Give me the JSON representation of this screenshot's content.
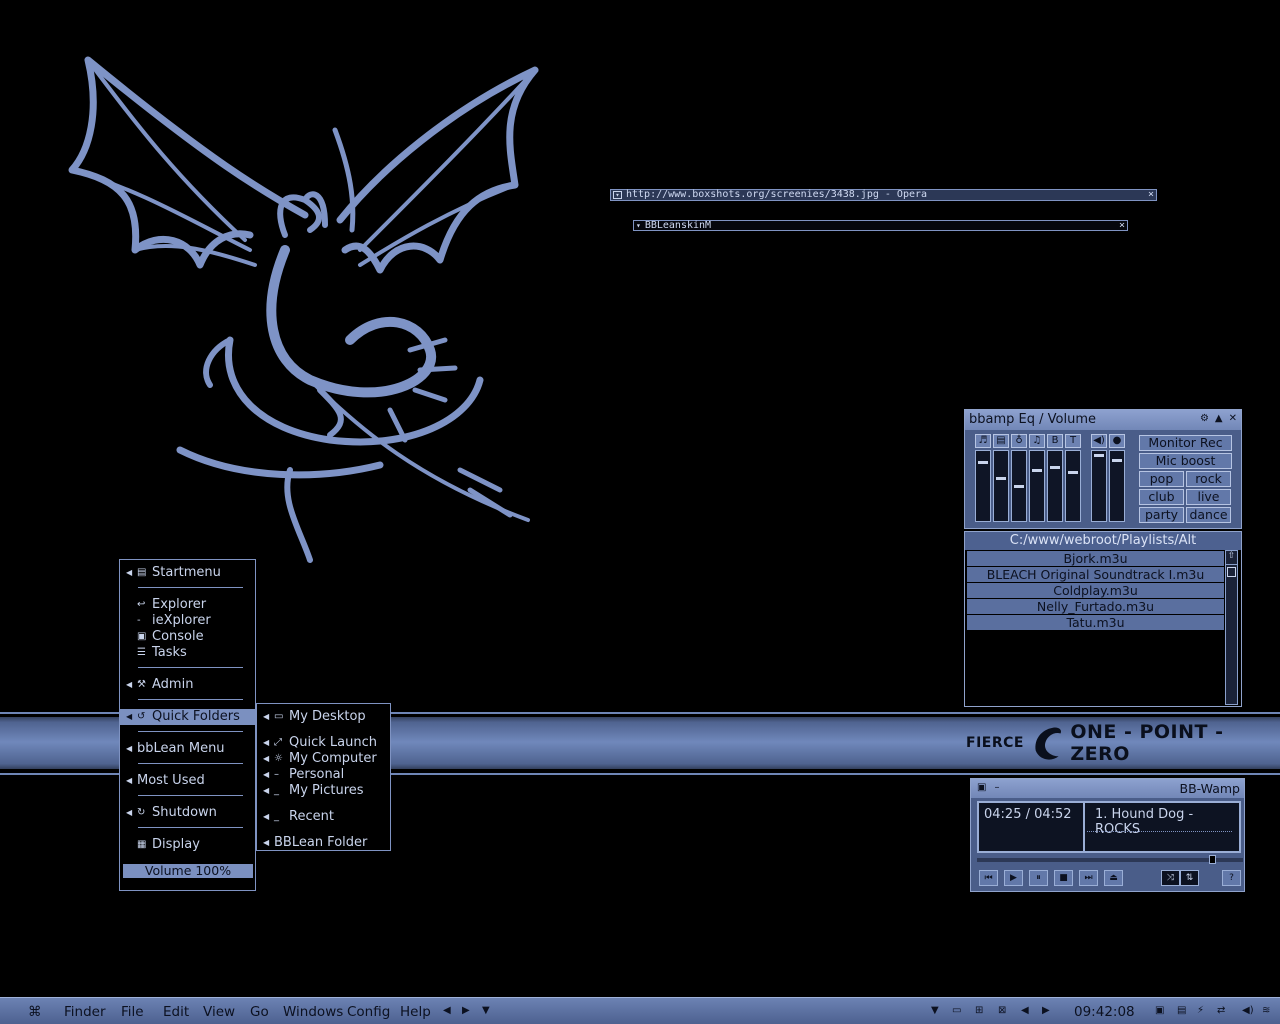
{
  "windows": {
    "opera_title": "http://www.boxshots.org/screenies/3438.jpg - Opera",
    "bbleanskin_title": "BBLeanskinM"
  },
  "brand": {
    "left": "FIERCE",
    "right": "ONE - POINT - ZERO"
  },
  "bbamp": {
    "title": "bbamp Eq / Volume",
    "eq_labels": [
      "♬",
      "▤",
      "♁",
      "♫",
      "B",
      "T",
      "◀)",
      "●"
    ],
    "eq_levels": [
      0.15,
      0.4,
      0.52,
      0.28,
      0.22,
      0.3,
      0.05,
      0.12
    ],
    "presets": [
      "Monitor Rec",
      "Mic boost",
      "pop",
      "rock",
      "club",
      "live",
      "party",
      "dance"
    ]
  },
  "playlist": {
    "path": "C:/www/webroot/Playlists/Alt",
    "items": [
      "Bjork.m3u",
      "BLEACH Original Soundtrack I.m3u",
      "Coldplay.m3u",
      "Nelly_Furtado.m3u",
      "Tatu.m3u"
    ]
  },
  "wamp": {
    "title": "BB-Wamp",
    "time": "04:25 / 04:52",
    "song": "1. Hound Dog - ROCKS",
    "progress": 0.91,
    "controls": [
      "⏮",
      "▶",
      "⏸",
      "■",
      "⏭",
      "⏏"
    ],
    "toggles": [
      "⤨",
      "⇅"
    ],
    "help": "?"
  },
  "menu": {
    "items": [
      {
        "label": "Startmenu",
        "icon": "▤",
        "arrow": true
      },
      {
        "label": "Explorer",
        "icon": "↩",
        "arrow": false
      },
      {
        "label": "ieXplorer",
        "icon": "-",
        "arrow": false
      },
      {
        "label": "Console",
        "icon": "▣",
        "arrow": false
      },
      {
        "label": "Tasks",
        "icon": "☰",
        "arrow": false
      },
      {
        "label": "Admin",
        "icon": "⚒",
        "arrow": true
      },
      {
        "label": "Quick Folders",
        "icon": "↺",
        "arrow": true
      },
      {
        "label": "bbLean Menu",
        "icon": "",
        "arrow": true
      },
      {
        "label": "Most Used",
        "icon": "",
        "arrow": true
      },
      {
        "label": "Shutdown",
        "icon": "↻",
        "arrow": true
      },
      {
        "label": "Display",
        "icon": "▦",
        "arrow": false
      }
    ],
    "volume": "Volume 100%"
  },
  "submenu": {
    "items": [
      {
        "label": "My Desktop",
        "icon": "▭"
      },
      {
        "label": "Quick Launch",
        "icon": "⤢"
      },
      {
        "label": "My Computer",
        "icon": "☼"
      },
      {
        "label": "Personal",
        "icon": "–"
      },
      {
        "label": "My Pictures",
        "icon": "_"
      },
      {
        "label": "Recent",
        "icon": "_"
      },
      {
        "label": "BBLean Folder",
        "icon": ""
      }
    ]
  },
  "taskbar": {
    "apple": "",
    "menus": [
      "Finder",
      "File",
      "Edit",
      "View",
      "Go",
      "Windows",
      "Config",
      "Help"
    ],
    "clock": "09:42:08"
  }
}
